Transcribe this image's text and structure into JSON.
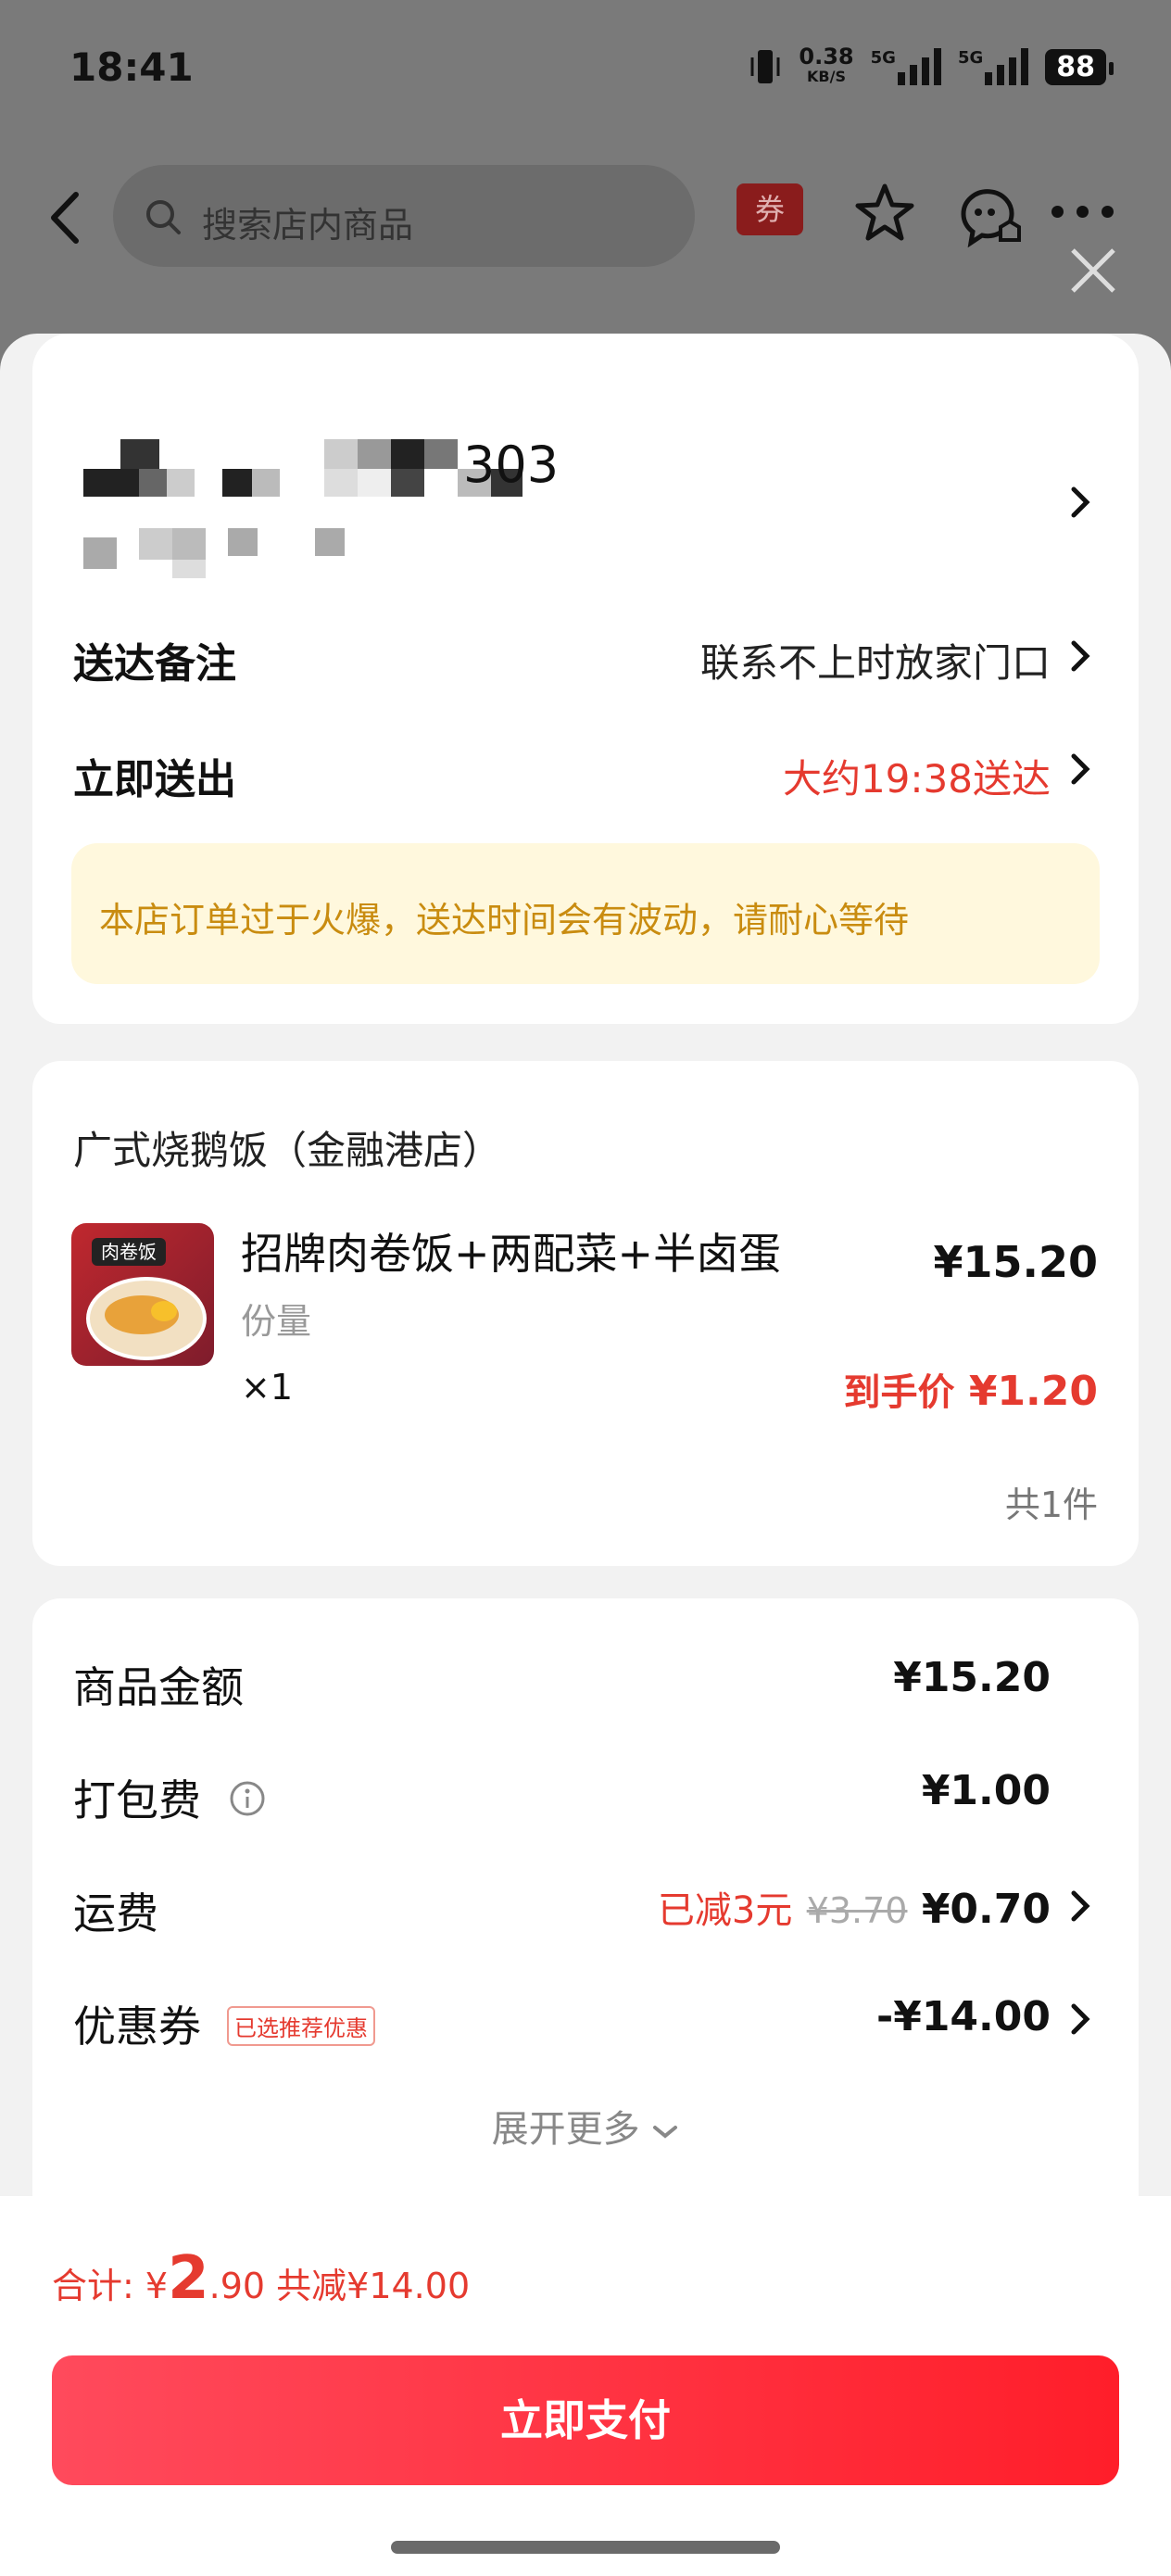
{
  "status_bar": {
    "time": "18:41",
    "net_speed": "0.38",
    "net_unit": "KB/S",
    "sig1_label": "5G",
    "sig2_label": "5G",
    "battery": "88"
  },
  "nav": {
    "search_placeholder": "搜索店内商品",
    "coupon_label": "券"
  },
  "address": {
    "partial_text": "303"
  },
  "delivery": {
    "note_label": "送达备注",
    "note_value": "联系不上时放家门口",
    "time_label": "立即送出",
    "time_value": "大约19:38送达",
    "notice": "本店订单过于火爆，送达时间会有波动，请耐心等待"
  },
  "order": {
    "shop_name": "广式烧鹅饭（金融港店）",
    "item": {
      "thumb_label": "肉卷饭",
      "name": "招牌肉卷饭+两配菜+半卤蛋",
      "spec": "份量",
      "qty": "×1",
      "price": "¥15.20",
      "final_label": "到手价",
      "final_price": "¥1.20"
    },
    "count": "共1件"
  },
  "fees": {
    "goods_label": "商品金额",
    "goods_value": "¥15.20",
    "pack_label": "打包费",
    "pack_value": "¥1.00",
    "delivery_label": "运费",
    "delivery_discount": "已减3元",
    "delivery_original": "¥3.70",
    "delivery_value": "¥0.70",
    "coupon_label": "优惠券",
    "coupon_badge": "已选推荐优惠",
    "coupon_value": "-¥14.00",
    "expand_label": "展开更多"
  },
  "footer": {
    "total_label": "合计:",
    "currency": "¥",
    "total_int": "2",
    "total_dec": ".90",
    "saved": "共减¥14.00",
    "pay_button": "立即支付"
  },
  "colors": {
    "accent_red": "#e53a2f",
    "notice_bg": "#fff8dd",
    "notice_text": "#c98c10",
    "pay_gradient_start": "#ff4a5c",
    "pay_gradient_end": "#ff1e2a"
  }
}
